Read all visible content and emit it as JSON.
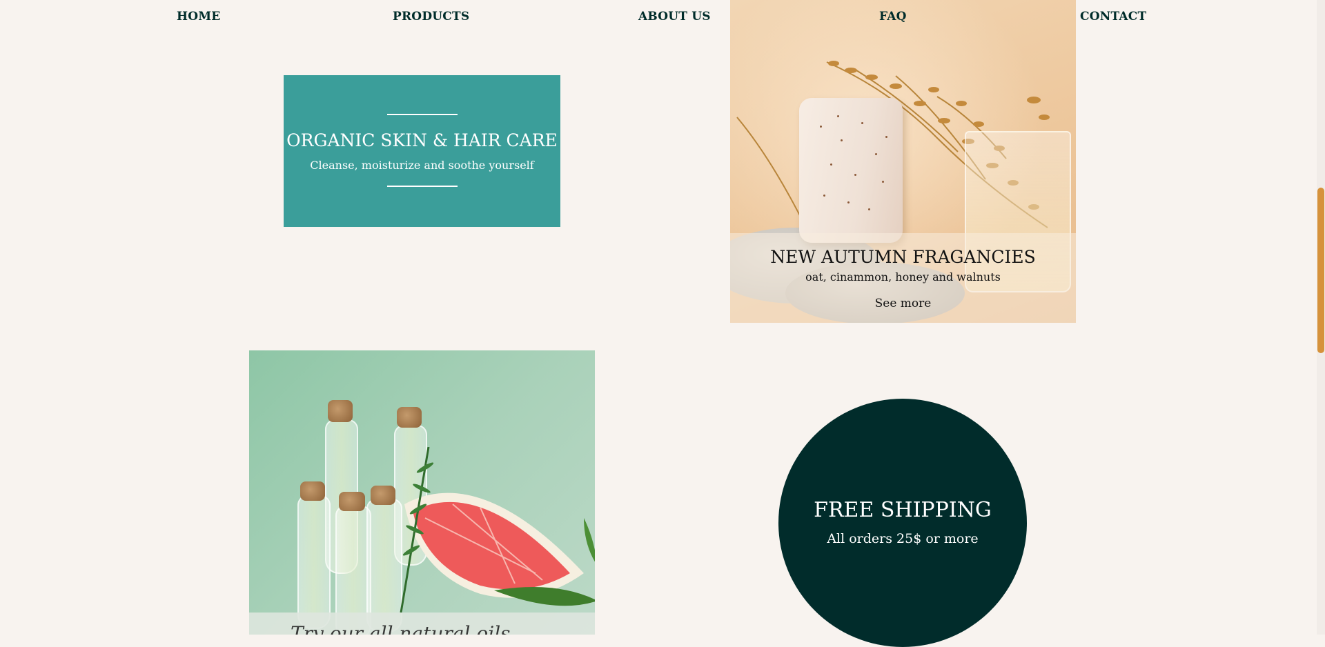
{
  "nav": {
    "home": "HOME",
    "products": "PRODUCTS",
    "about": "ABOUT US",
    "faq": "FAQ",
    "contact": "CONTACT"
  },
  "promo": {
    "title": "ORGANIC SKIN & HAIR CARE",
    "subtitle": "Cleanse, moisturize and soothe yourself"
  },
  "autumn": {
    "title": "NEW AUTUMN FRAGANCIES",
    "subtitle": "oat, cinammon, honey and walnuts",
    "link": "See more"
  },
  "oils": {
    "caption": "Try our all natural oils"
  },
  "shipping": {
    "title": "FREE SHIPPING",
    "subtitle": "All orders 25$ or more"
  },
  "colors": {
    "background": "#f8f3ef",
    "teal": "#3b9e9a",
    "dark_green": "#012c2b",
    "scroll_thumb": "#d6923b"
  }
}
